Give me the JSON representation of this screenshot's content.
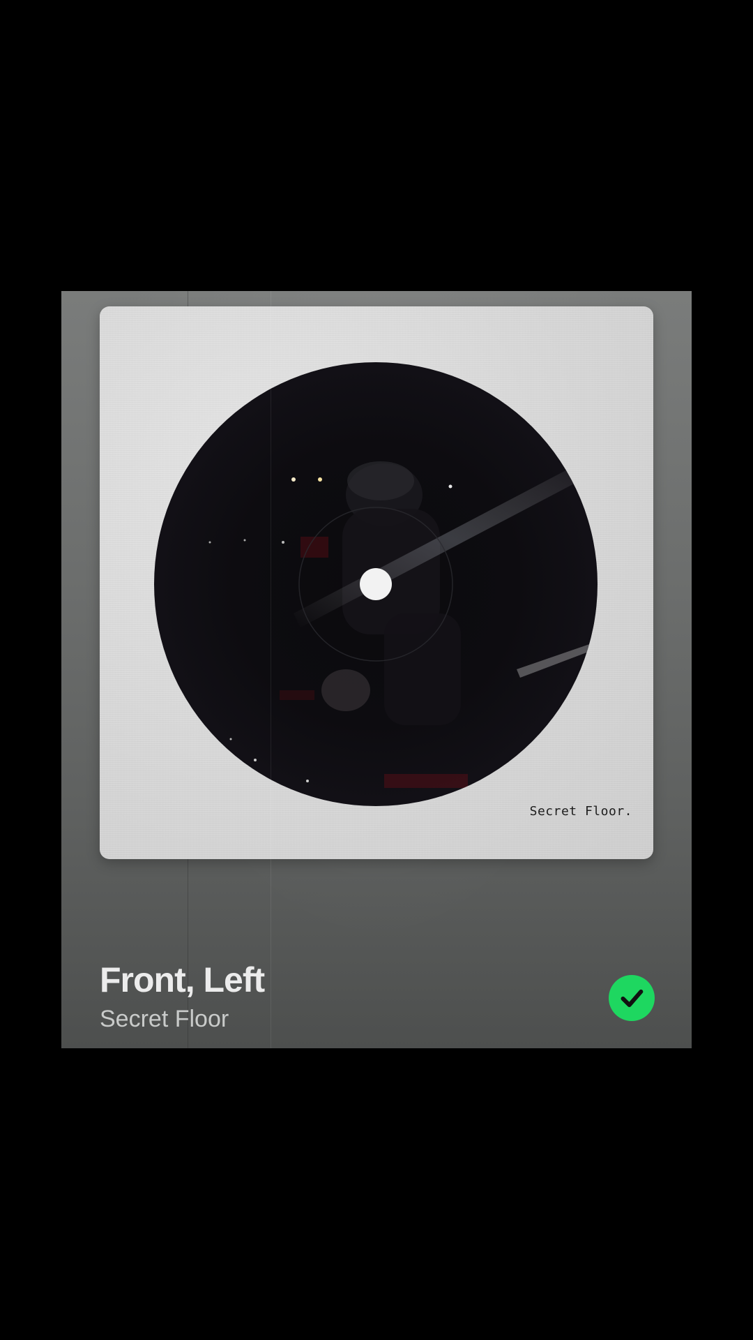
{
  "track": {
    "title": "Front, Left",
    "artist": "Secret Floor"
  },
  "cover": {
    "caption": "Secret Floor."
  },
  "saved_button": {
    "icon": "checkmark-icon",
    "state": "saved"
  },
  "colors": {
    "background": "#000000",
    "card_gradient_top": "#7a7c7b",
    "card_gradient_bottom": "#4d4f4e",
    "accent_green": "#1ed760",
    "title_text": "#ececec",
    "artist_text": "#c9cbca"
  }
}
